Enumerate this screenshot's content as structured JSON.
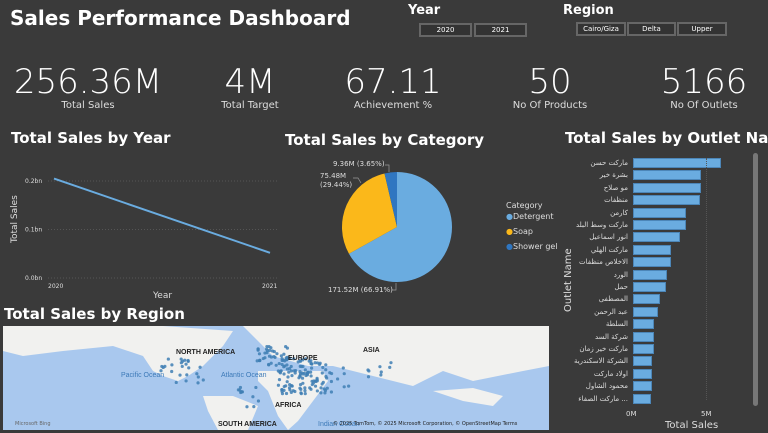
{
  "title": "Sales Performance Dashboard",
  "slicers": {
    "year": {
      "label": "Year",
      "options": [
        "2020",
        "2021"
      ]
    },
    "region": {
      "label": "Region",
      "options": [
        "Cairo/Giza",
        "Delta",
        "Upper"
      ]
    }
  },
  "kpis": [
    {
      "value": "256.36M",
      "label": "Total Sales"
    },
    {
      "value": "4M",
      "label": "Total Target"
    },
    {
      "value": "67.11",
      "label": "Achievement %"
    },
    {
      "value": "50",
      "label": "No Of Products"
    },
    {
      "value": "5166",
      "label": "No Of Outlets"
    }
  ],
  "colors": {
    "background": "#3a3a3a",
    "line": "#6aace0",
    "detergent": "#6aace0",
    "soap": "#fbb81a",
    "shower": "#2f76c1",
    "map_water": "#a9c8ee",
    "map_land": "#f1f1ef",
    "dot": "#3f7fb4"
  },
  "chart_data": [
    {
      "type": "line",
      "title": "Total Sales by Year",
      "xlabel": "Year",
      "ylabel": "Total Sales",
      "x": [
        "2020",
        "2021"
      ],
      "values": [
        0.205,
        0.052
      ],
      "yticks": [
        "0.0bn",
        "0.1bn",
        "0.2bn"
      ],
      "ylim": [
        0,
        0.2
      ]
    },
    {
      "type": "pie",
      "title": "Total Sales by Category",
      "legend_title": "Category",
      "legend_position": "right",
      "categories": [
        "Detergent",
        "Soap",
        "Shower gel"
      ],
      "values": [
        171.52,
        75.48,
        9.36
      ],
      "percents": [
        66.91,
        29.44,
        3.65
      ],
      "data_labels": [
        "171.52M (66.91%)",
        "75.48M (29.44%)",
        "9.36M (3.65%)"
      ]
    },
    {
      "type": "bar",
      "title": "Total Sales by Outlet Name",
      "xlabel": "Total Sales",
      "ylabel": "Outlet Name",
      "xticks": [
        "0M",
        "5M"
      ],
      "xlim": [
        0,
        7
      ],
      "categories": [
        "ماركت حسن",
        "بشرة خير",
        "مو صلاح",
        "منظفات",
        "كارمن",
        "ماركت وسط البلد",
        "انور اسماعيل",
        "ماركت الهلي",
        "الاخلاص منظفات",
        "الورد",
        "حمل",
        "المصطفى",
        "عبد الرحمن",
        "السلطة",
        "شركة السد",
        "ماركت خير زمان",
        "الشركة الاسكندرية",
        "اولاد ماركت",
        "محمود الشاول",
        "... ماركت الصفاء"
      ],
      "values": [
        5.95,
        4.6,
        4.57,
        4.5,
        3.6,
        3.6,
        3.2,
        2.6,
        2.6,
        2.3,
        2.2,
        1.8,
        1.7,
        1.45,
        1.45,
        1.4,
        1.3,
        1.3,
        1.25,
        1.2
      ]
    }
  ],
  "map": {
    "title": "Total Sales by Region",
    "labels": [
      "NORTH AMERICA",
      "EUROPE",
      "ASIA",
      "AFRICA",
      "SOUTH AMERICA",
      "Pacific Ocean",
      "Atlantic Ocean",
      "Indian Ocean"
    ],
    "attribution": "© 2025 TomTom, © 2025 Microsoft Corporation, © OpenStreetMap Terms",
    "logo": "Microsoft Bing"
  }
}
